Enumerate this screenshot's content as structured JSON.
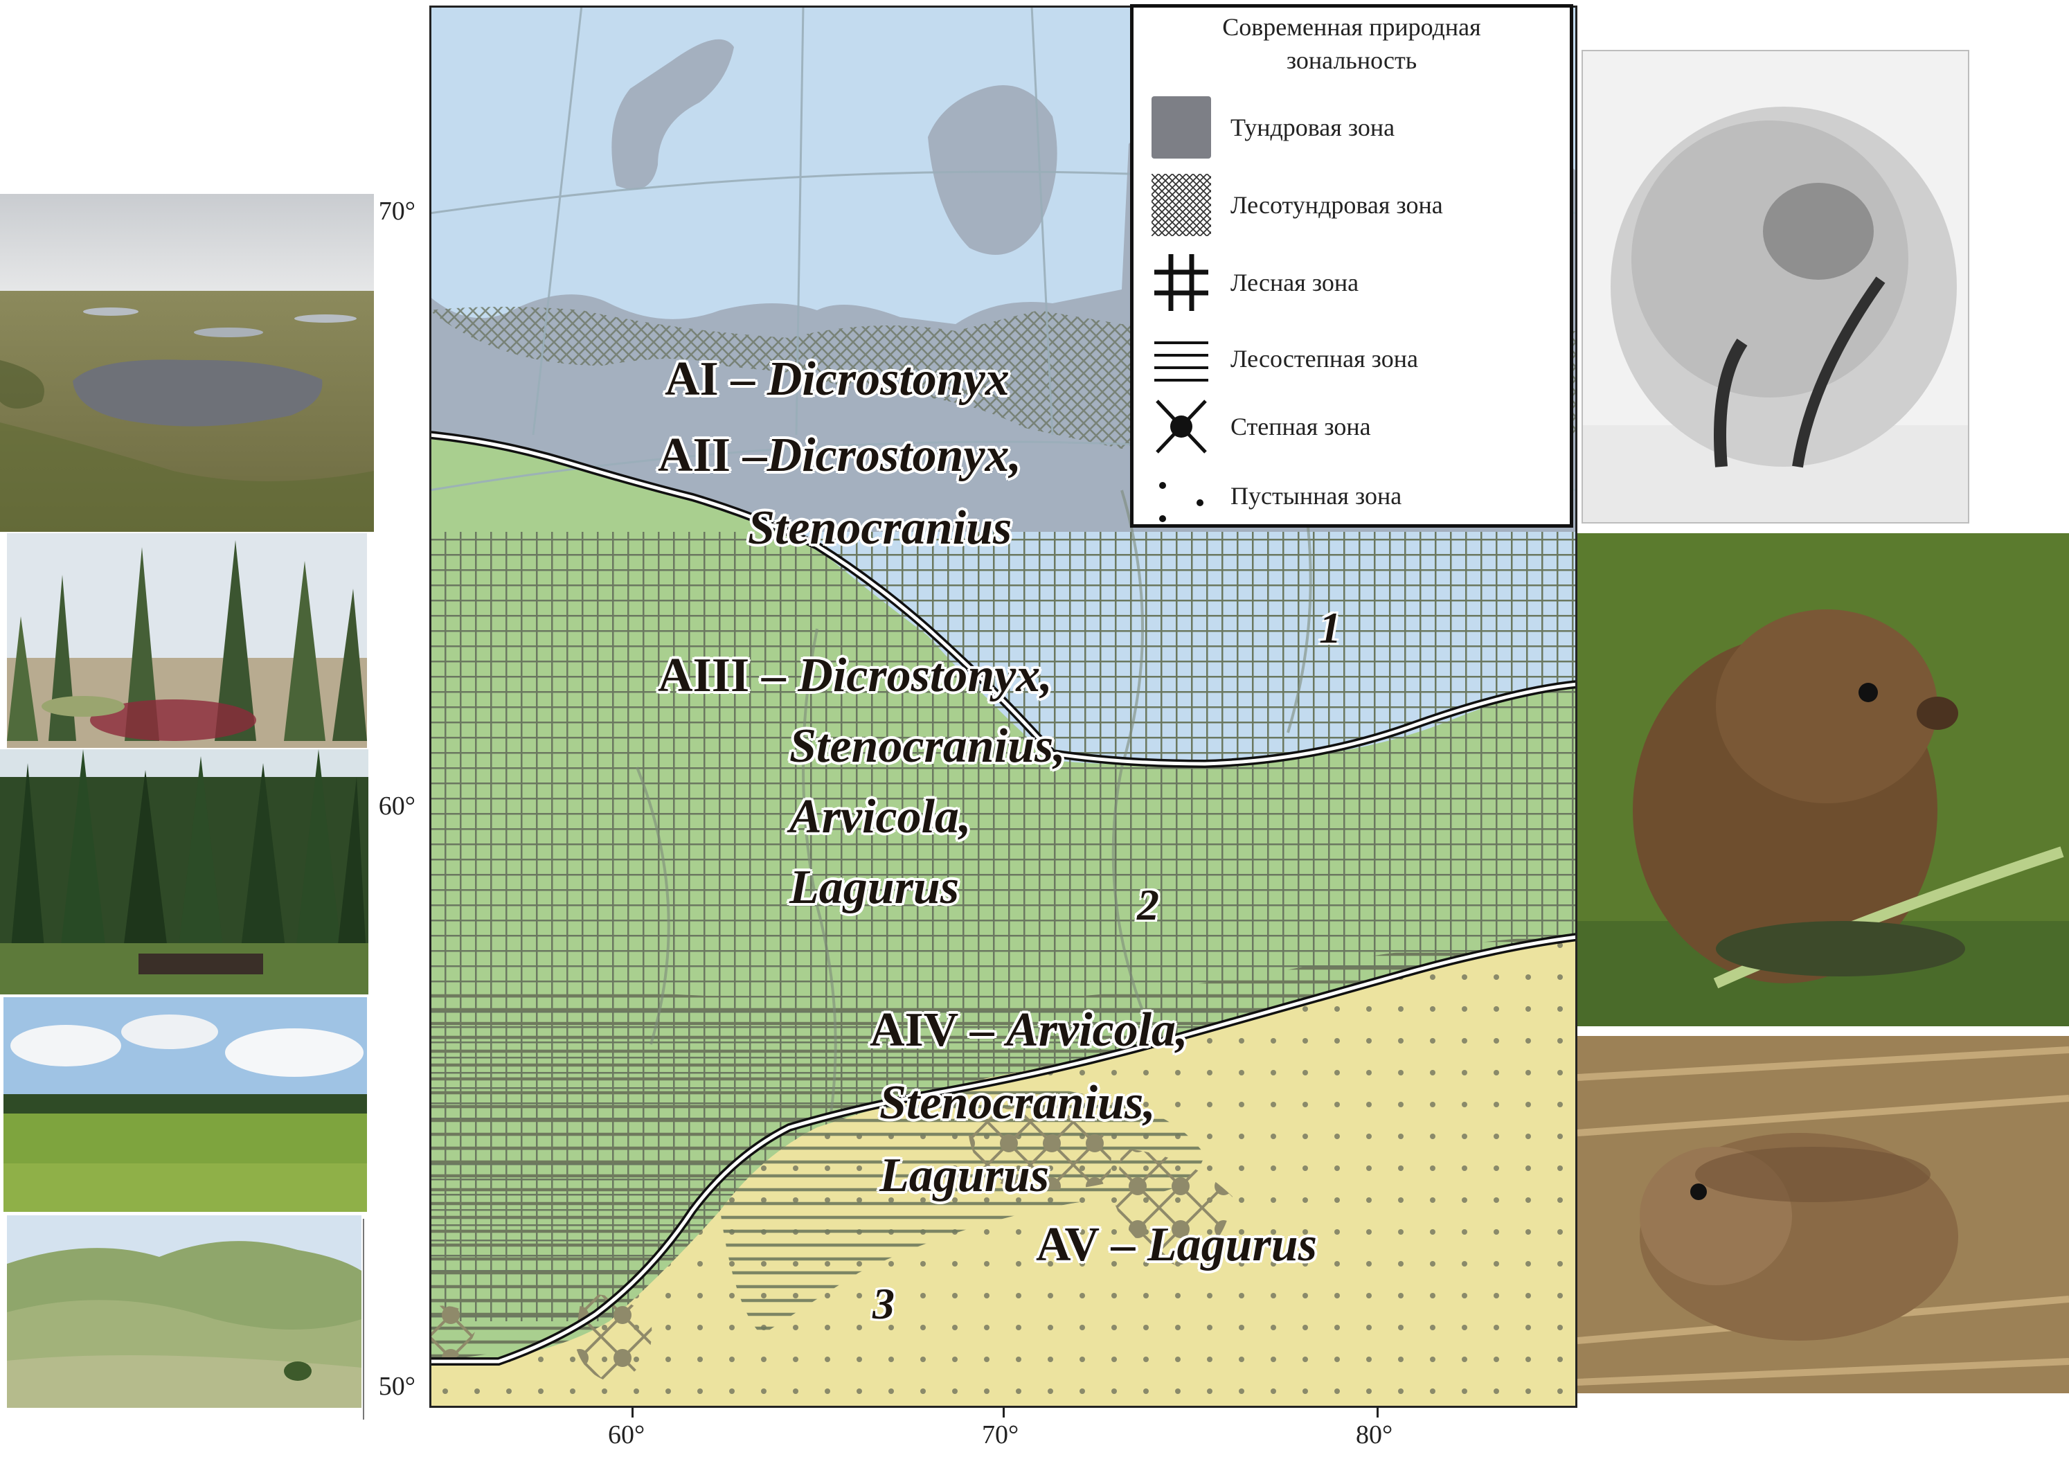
{
  "legend": {
    "title_line1": "Современная природная",
    "title_line2": "зональность",
    "items": [
      {
        "label": "Тундровая зона",
        "pattern": "solid-gray"
      },
      {
        "label": "Лесотундровая зона",
        "pattern": "cross-hatch"
      },
      {
        "label": "Лесная зона",
        "pattern": "grid"
      },
      {
        "label": "Лесостепная зона",
        "pattern": "horizontal-lines"
      },
      {
        "label": "Степная зона",
        "pattern": "x-dot"
      },
      {
        "label": "Пустынная зона",
        "pattern": "dots"
      }
    ]
  },
  "axes": {
    "lat_labels": [
      "70°",
      "60°",
      "50°"
    ],
    "lon_labels": [
      "60°",
      "70°",
      "80°"
    ]
  },
  "regions": [
    {
      "code": "AI",
      "separator": " – ",
      "genera": [
        "Dicrostonyx"
      ]
    },
    {
      "code": "AII",
      "separator": " –",
      "genera": [
        "Dicrostonyx,",
        "Stenocranius"
      ]
    },
    {
      "code": "AIII",
      "separator": " – ",
      "genera": [
        "Dicrostonyx,",
        "Stenocranius,",
        "Arvicola,",
        "Lagurus"
      ]
    },
    {
      "code": "AIV",
      "separator": " – ",
      "genera": [
        "Arvicola,",
        "Stenocranius,",
        "Lagurus"
      ]
    },
    {
      "code": "AV",
      "separator": " – ",
      "genera": [
        "Lagurus"
      ]
    }
  ],
  "zone_numbers": [
    "1",
    "2",
    "3"
  ],
  "colors": {
    "sea": "#c3dbef",
    "tundra_land": "#9aa7b6",
    "forest_green": "#a9cf8f",
    "desert_yellow": "#ece39f",
    "pattern_stroke": "#707a6a",
    "boundary_line": "#111111"
  }
}
